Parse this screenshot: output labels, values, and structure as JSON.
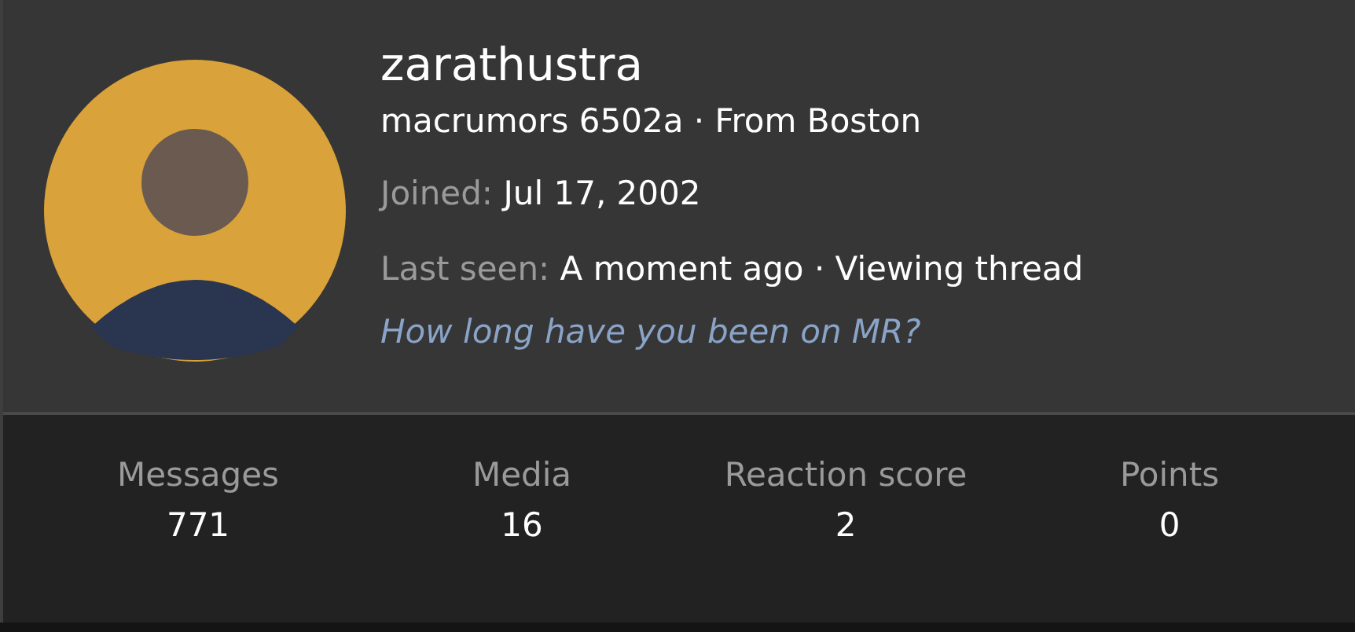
{
  "user": {
    "name": "zarathustra",
    "title_line": "macrumors 6502a · From Boston",
    "joined_label": "Joined:",
    "joined": "Jul 17, 2002",
    "last_seen_label": "Last seen:",
    "last_seen": "A moment ago · Viewing thread",
    "link": "How long have you been on MR?"
  },
  "stats": [
    {
      "label": "Messages",
      "value": "771"
    },
    {
      "label": "Media",
      "value": "16"
    },
    {
      "label": "Reaction score",
      "value": "2"
    },
    {
      "label": "Points",
      "value": "0"
    }
  ]
}
